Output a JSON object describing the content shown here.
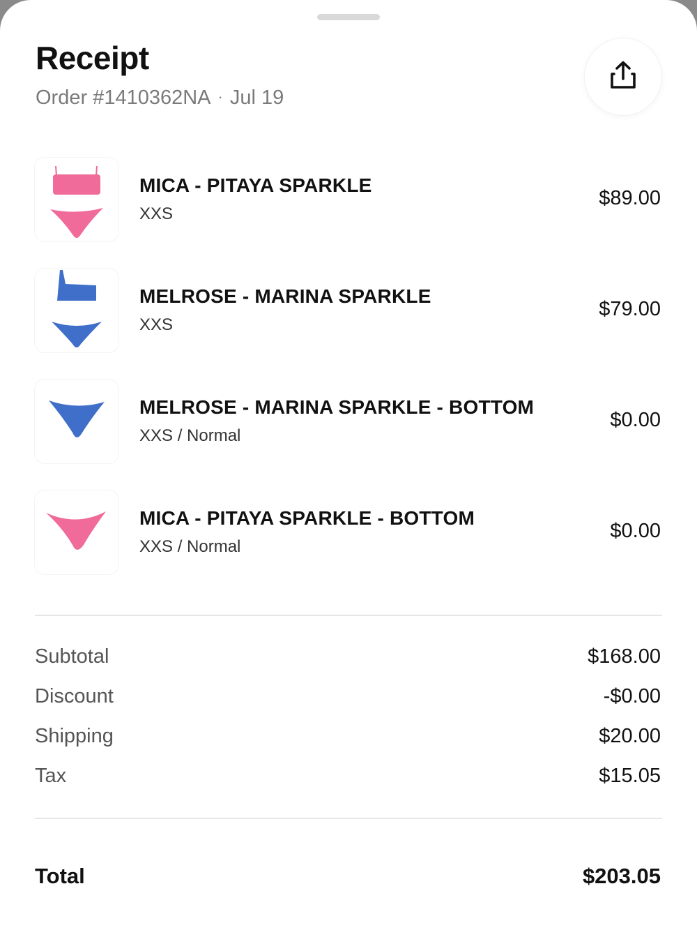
{
  "receipt": {
    "title": "Receipt",
    "order_number": "Order #1410362NA",
    "separator": "·",
    "date": "Jul 19",
    "share_icon": "share-upload-icon"
  },
  "items": [
    {
      "name": "MICA - PITAYA SPARKLE",
      "variant": "XXS",
      "price": "$89.00",
      "thumbnail": "pink-bikini-set",
      "color": "#f06a9a"
    },
    {
      "name": "MELROSE - MARINA SPARKLE",
      "variant": "XXS",
      "price": "$79.00",
      "thumbnail": "blue-bikini-set",
      "color": "#3f6fc9"
    },
    {
      "name": "MELROSE - MARINA SPARKLE - BOTTOM",
      "variant": "XXS / Normal",
      "price": "$0.00",
      "thumbnail": "blue-bikini-bottom",
      "color": "#3f6fc9"
    },
    {
      "name": "MICA - PITAYA SPARKLE - BOTTOM",
      "variant": "XXS / Normal",
      "price": "$0.00",
      "thumbnail": "pink-bikini-bottom",
      "color": "#f06a9a"
    }
  ],
  "summary": {
    "subtotal": {
      "label": "Subtotal",
      "value": "$168.00"
    },
    "discount": {
      "label": "Discount",
      "value": "-$0.00"
    },
    "shipping": {
      "label": "Shipping",
      "value": "$20.00"
    },
    "tax": {
      "label": "Tax",
      "value": "$15.05"
    },
    "total": {
      "label": "Total",
      "value": "$203.05"
    }
  }
}
